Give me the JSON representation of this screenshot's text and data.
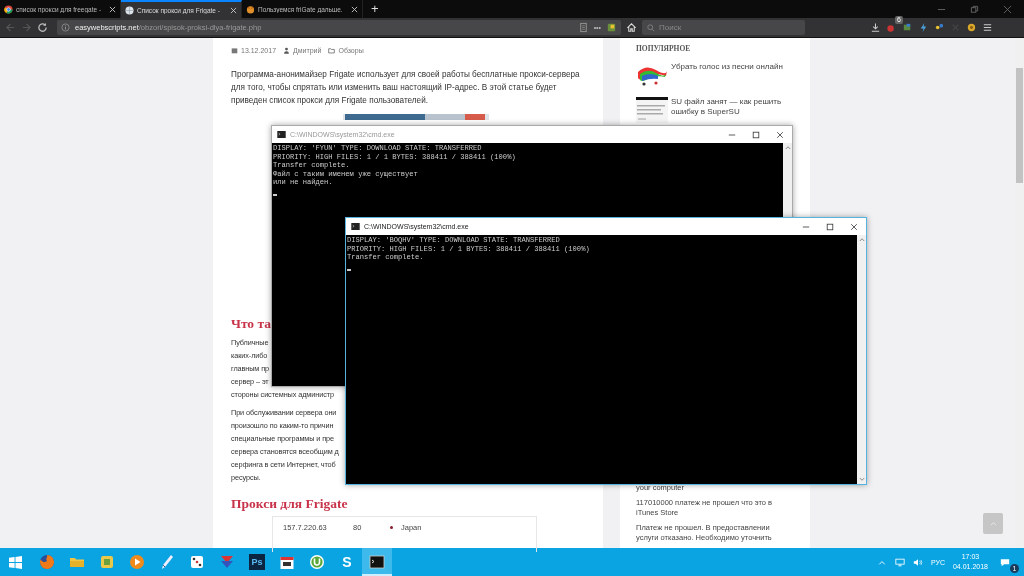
{
  "browser": {
    "tabs": [
      {
        "title": "список прокси для freegate -",
        "selected": false
      },
      {
        "title": "Список прокси для Frigate -",
        "selected": true
      },
      {
        "title": "Пользуемся friGate дальше.",
        "selected": false
      }
    ],
    "new_tab": "+",
    "address": {
      "domain": "easywebscripts.net",
      "path": "/obzori/spisok-proksi-dlya-frigate.php"
    },
    "more": "•••",
    "search": {
      "placeholder": "Поиск"
    },
    "extension_badge": "6"
  },
  "article": {
    "meta": {
      "date": "13.12.2017",
      "author": "Дмитрий",
      "category": "Обзоры"
    },
    "intro": "Программа-анонимайзер Frigate использует для своей работы бесплатные прокси-сервера для того, чтобы спрятать или изменить ваш настоящий IP-адрес. В этой статье будет приведен список прокси для Frigate пользователей.",
    "heading_1": "Что та",
    "paragraph_1_lines": [
      "Публичные",
      "каких-либо",
      "главным пр",
      "сервер – эт",
      "стороны системных администр"
    ],
    "paragraph_2_lines": [
      "При обслуживании сервера они",
      "произошло по каким-то причин",
      "специальные программы и пре",
      "сервера становятся всеобщим д",
      "серфинга в сети Интернет, чтоб",
      "ресурсы."
    ],
    "heading_2": "Прокси для Frigate",
    "proxy_rows": [
      {
        "ip": "157.7.220.63",
        "port": "80",
        "country": "Japan"
      }
    ]
  },
  "sidebar": {
    "heading": "ПОПУЛЯРНОЕ",
    "items": [
      {
        "title": "Убрать голос из песни онлайн"
      },
      {
        "title": "SU файл занят — как решить ошибку в SuperSU"
      }
    ],
    "lower_items": [
      "your computer",
      "117010000 платеж не прошел что это в iTunes Store",
      "Платеж не прошел. В предоставлении услуги отказано. Необходимо уточнить"
    ]
  },
  "consoles": [
    {
      "title": "C:\\WINDOWS\\system32\\cmd.exe",
      "active": false,
      "lines": [
        "DISPLAY: 'FYUN' TYPE: DOWNLOAD STATE: TRANSFERRED",
        "PRIORITY: HIGH FILES: 1 / 1 BYTES: 388411 / 388411 (100%)",
        "Transfer complete.",
        "Файл с таким именем уже существует",
        "или не найден."
      ]
    },
    {
      "title": "C:\\WINDOWS\\system32\\cmd.exe",
      "active": true,
      "lines": [
        "DISPLAY: 'BOQHV' TYPE: DOWNLOAD STATE: TRANSFERRED",
        "PRIORITY: HIGH FILES: 1 / 1 BYTES: 388411 / 388411 (100%)",
        "Transfer complete."
      ]
    }
  ],
  "taskbar": {
    "apps": [
      {
        "kind": "firefox",
        "active": false
      },
      {
        "kind": "folder",
        "active": false
      },
      {
        "kind": "tiles",
        "active": false
      },
      {
        "kind": "player",
        "active": false
      },
      {
        "kind": "pen",
        "active": false
      },
      {
        "kind": "dice",
        "active": false
      },
      {
        "kind": "arrow",
        "active": false
      },
      {
        "kind": "ps",
        "label": "Ps",
        "active": false
      },
      {
        "kind": "calendar",
        "active": false
      },
      {
        "kind": "torrent",
        "active": false
      },
      {
        "kind": "letter",
        "label": "S",
        "active": false
      },
      {
        "kind": "console",
        "active": true
      }
    ],
    "tray": {
      "language": "РУС",
      "time": "17:03",
      "date": "04.01.2018",
      "notifications": "1"
    }
  }
}
